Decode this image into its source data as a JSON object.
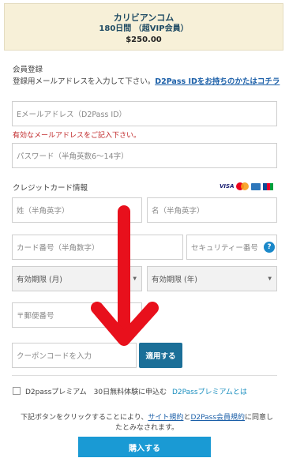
{
  "header": {
    "title": "カリビアンコム",
    "plan": "180日間 （超VIP会員）",
    "price": "$250.00"
  },
  "registration": {
    "section_label": "会員登録",
    "instruction": "登録用メールアドレスを入力して下さい。",
    "d2pass_link": "D2Pass IDをお持ちのかたはコチラ",
    "email_placeholder": "Eメールアドレス（D2Pass ID）",
    "email_error": "有効なメールアドレスをご記入下さい。",
    "password_placeholder": "パスワード（半角英数6〜14字）"
  },
  "credit": {
    "section_label": "クレジットカード情報",
    "brand_visa": "VISA",
    "lastname_placeholder": "姓（半角英字）",
    "firstname_placeholder": "名（半角英字）",
    "card_number_placeholder": "カード番号（半角数字）",
    "security_placeholder": "セキュリティー番号",
    "security_help": "?",
    "expiry_month": "有効期限 (月)",
    "expiry_year": "有効期限 (年)",
    "zip_placeholder": "〒郵便番号"
  },
  "coupon": {
    "placeholder": "クーポンコードを入力",
    "apply_label": "適用する"
  },
  "premium": {
    "label": "D2passプレミアム　30日無料体験に申込む",
    "link": "D2Passプレミアムとは"
  },
  "agreement": {
    "text_before": "下記ボタンをクリックすることにより、",
    "terms_link": "サイト規約",
    "and": "と",
    "member_terms_link": "D2Pass会員規約",
    "text_after": "に同意したとみなされます。"
  },
  "buy_label": "購入する",
  "colors": {
    "accent_arrow": "#e8101c",
    "button": "#1a9ad4",
    "apply_button": "#1b6f98"
  },
  "icons": {
    "overlay": "red-down-arrow-icon"
  }
}
